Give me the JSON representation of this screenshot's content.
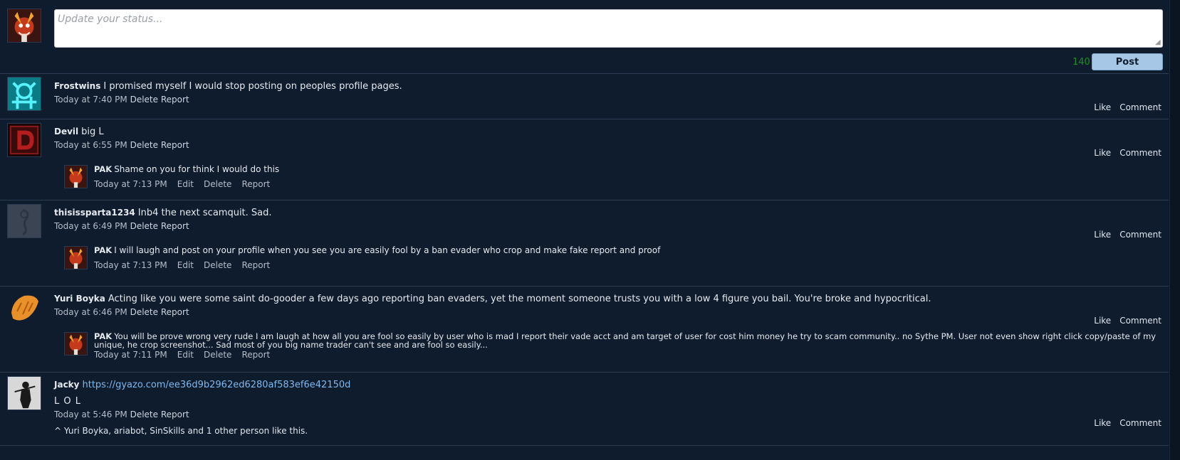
{
  "status": {
    "placeholder": "Update your status...",
    "char_count": "140",
    "post_label": "Post"
  },
  "feed": [
    {
      "user": "Frostwins",
      "message": "I promised myself I would stop posting on peoples profile pages.",
      "time": "Today at 7:40 PM",
      "delete": "Delete",
      "report": "Report",
      "like": "Like",
      "comment": "Comment"
    },
    {
      "user": "Devil",
      "message": "big L",
      "time": "Today at 6:55 PM",
      "delete": "Delete",
      "report": "Report",
      "like": "Like",
      "comment": "Comment",
      "reply": {
        "user": "PAK",
        "text": "Shame on you for think I would do this",
        "time": "Today at 7:13 PM",
        "edit": "Edit",
        "delete": "Delete",
        "report": "Report"
      }
    },
    {
      "user": "thisissparta1234",
      "message": "Inb4 the next scamquit. Sad.",
      "time": "Today at 6:49 PM",
      "delete": "Delete",
      "report": "Report",
      "like": "Like",
      "comment": "Comment",
      "reply": {
        "user": "PAK",
        "text": "I will laugh and post on your profile when you see you are easily fool by a ban evader who crop and make fake report and proof",
        "time": "Today at 7:13 PM",
        "edit": "Edit",
        "delete": "Delete",
        "report": "Report"
      }
    },
    {
      "user": "Yuri Boyka",
      "message": "Acting like you were some saint do-gooder a few days ago reporting ban evaders, yet the moment someone trusts you with a low 4 figure you bail. You're broke and hypocritical.",
      "time": "Today at 6:46 PM",
      "delete": "Delete",
      "report": "Report",
      "like": "Like",
      "comment": "Comment",
      "reply": {
        "user": "PAK",
        "text": "You will be prove wrong very rude I am laugh at how all you are fool so easily by user who is mad I report their vade acct and am target of user for cost him money he try to scam community.. no Sythe PM. User not even show right click copy/paste of my unique, he crop screenshot... Sad most of you big name trader can't see and are fool so easily...",
        "time": "Today at 7:11 PM",
        "edit": "Edit",
        "delete": "Delete",
        "report": "Report"
      }
    },
    {
      "user": "Jacky",
      "link": "https://gyazo.com/ee36d9b2962ed6280af583ef6e42150d",
      "extra": "L O L",
      "time": "Today at 5:46 PM",
      "delete": "Delete",
      "report": "Report",
      "like": "Like",
      "comment": "Comment",
      "likers": {
        "caret": "^",
        "names": "Yuri Boyka, ariabot, SinSkills",
        "and": "and",
        "other": "1 other person",
        "suffix": "like this."
      }
    }
  ],
  "colors": {
    "background": "#0f1c2d",
    "divider": "#2c3c52",
    "post_button": "#a6c7e5",
    "char_count": "#1e8f22",
    "link": "#7fb8ef"
  },
  "icons": {
    "self_avatar": "fire-demon-avatar",
    "frostwins": "cyan-rune-avatar",
    "devil": "red-d-logo-avatar",
    "thisissparta": "grey-sketch-avatar",
    "yuri": "orange-bread-avatar",
    "jacky": "samurai-avatar"
  }
}
